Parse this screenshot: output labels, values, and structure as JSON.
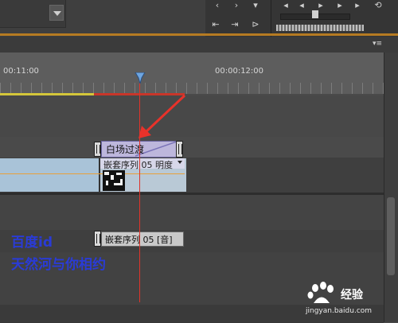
{
  "timeline": {
    "timecode_left": "00:11:00",
    "timecode_right": "00:00:12:00"
  },
  "clips": {
    "transition_label": "白场过渡",
    "nested_video_label": "嵌套序列 05  明度",
    "nested_audio_label": "嵌套序列 05 [音]"
  },
  "watermark": {
    "line1": "百度id",
    "line2": "天然河与你相约"
  },
  "logo": {
    "text": "经验",
    "url": "jingyan.baidu.com"
  },
  "colors": {
    "work_area": "#d4c63a",
    "playhead": "#e0342a",
    "video_clip": "#a9c3d8",
    "transition": "#bdb7dc",
    "watermark": "#2a3bd6"
  }
}
